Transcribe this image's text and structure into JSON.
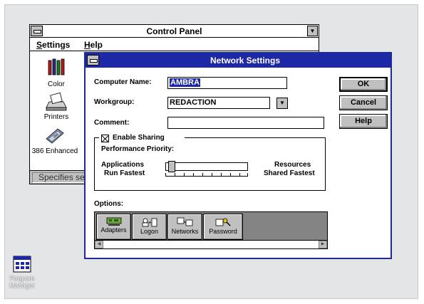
{
  "control_panel": {
    "title": "Control Panel",
    "menu": [
      "Settings",
      "Help"
    ],
    "icons": [
      {
        "label": "Color",
        "icon": "color-palette-icon"
      },
      {
        "label": "Printers",
        "icon": "printer-icon"
      },
      {
        "label": "386 Enhanced",
        "icon": "chip-icon"
      }
    ],
    "status": "Specifies se"
  },
  "network_dialog": {
    "title": "Network Settings",
    "computer_name_label": "Computer Name:",
    "computer_name_value": "AMBRA",
    "workgroup_label": "Workgroup:",
    "workgroup_value": "REDACTION",
    "comment_label": "Comment:",
    "comment_value": "",
    "enable_sharing_label": "Enable Sharing",
    "enable_sharing_checked": true,
    "performance_label": "Performance Priority:",
    "left_label_1": "Applications",
    "left_label_2": "Run Fastest",
    "right_label_1": "Resources",
    "right_label_2": "Shared Fastest",
    "slider_level": 0.0,
    "options_label": "Options:",
    "buttons": {
      "ok": "OK",
      "cancel": "Cancel",
      "help": "Help"
    },
    "option_buttons": [
      {
        "label": "Adapters",
        "icon": "network-card-icon"
      },
      {
        "label": "Logon",
        "icon": "user-logon-icon"
      },
      {
        "label": "Networks",
        "icon": "networks-icon"
      },
      {
        "label": "Password",
        "icon": "key-icon"
      }
    ]
  },
  "desktop": {
    "program_manager_line1": "Program",
    "program_manager_line2": "Manager"
  },
  "colors": {
    "title_active": "#1d28a6",
    "desktop": "#e4e5e7",
    "button_face": "#c0c0c0"
  }
}
